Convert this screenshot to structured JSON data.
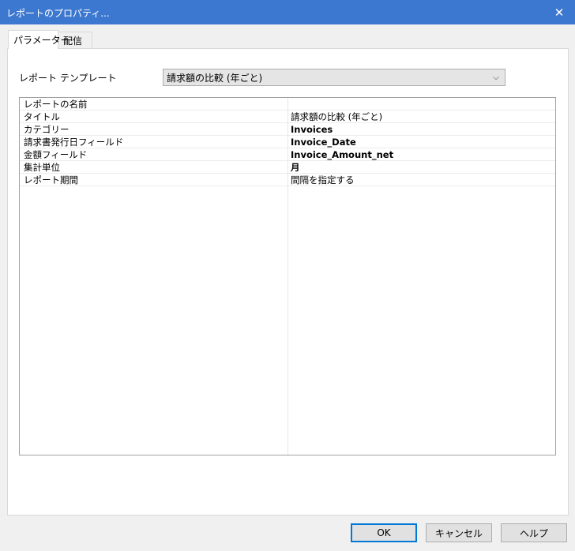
{
  "window": {
    "title": "レポートのプロパティ...",
    "close_symbol": "✕"
  },
  "tabs": [
    {
      "label": "パラメーター",
      "active": true
    },
    {
      "label": "配信",
      "active": false
    }
  ],
  "template": {
    "label": "レポート テンプレート",
    "selected": "請求額の比較 (年ごと)",
    "chevron": "⌵"
  },
  "properties": [
    {
      "key": "レポートの名前",
      "value": ""
    },
    {
      "key": "タイトル",
      "value": "請求額の比較 (年ごと)"
    },
    {
      "key": "カテゴリー",
      "value": "Invoices"
    },
    {
      "key": "請求書発行日フィールド",
      "value": "Invoice_Date"
    },
    {
      "key": "金額フィールド",
      "value": "Invoice_Amount_net"
    },
    {
      "key": "集計単位",
      "value": "月"
    },
    {
      "key": "レポート期間",
      "value": "間隔を指定する"
    }
  ],
  "buttons": {
    "ok": "OK",
    "cancel": "キャンセル",
    "help": "ヘルプ"
  }
}
